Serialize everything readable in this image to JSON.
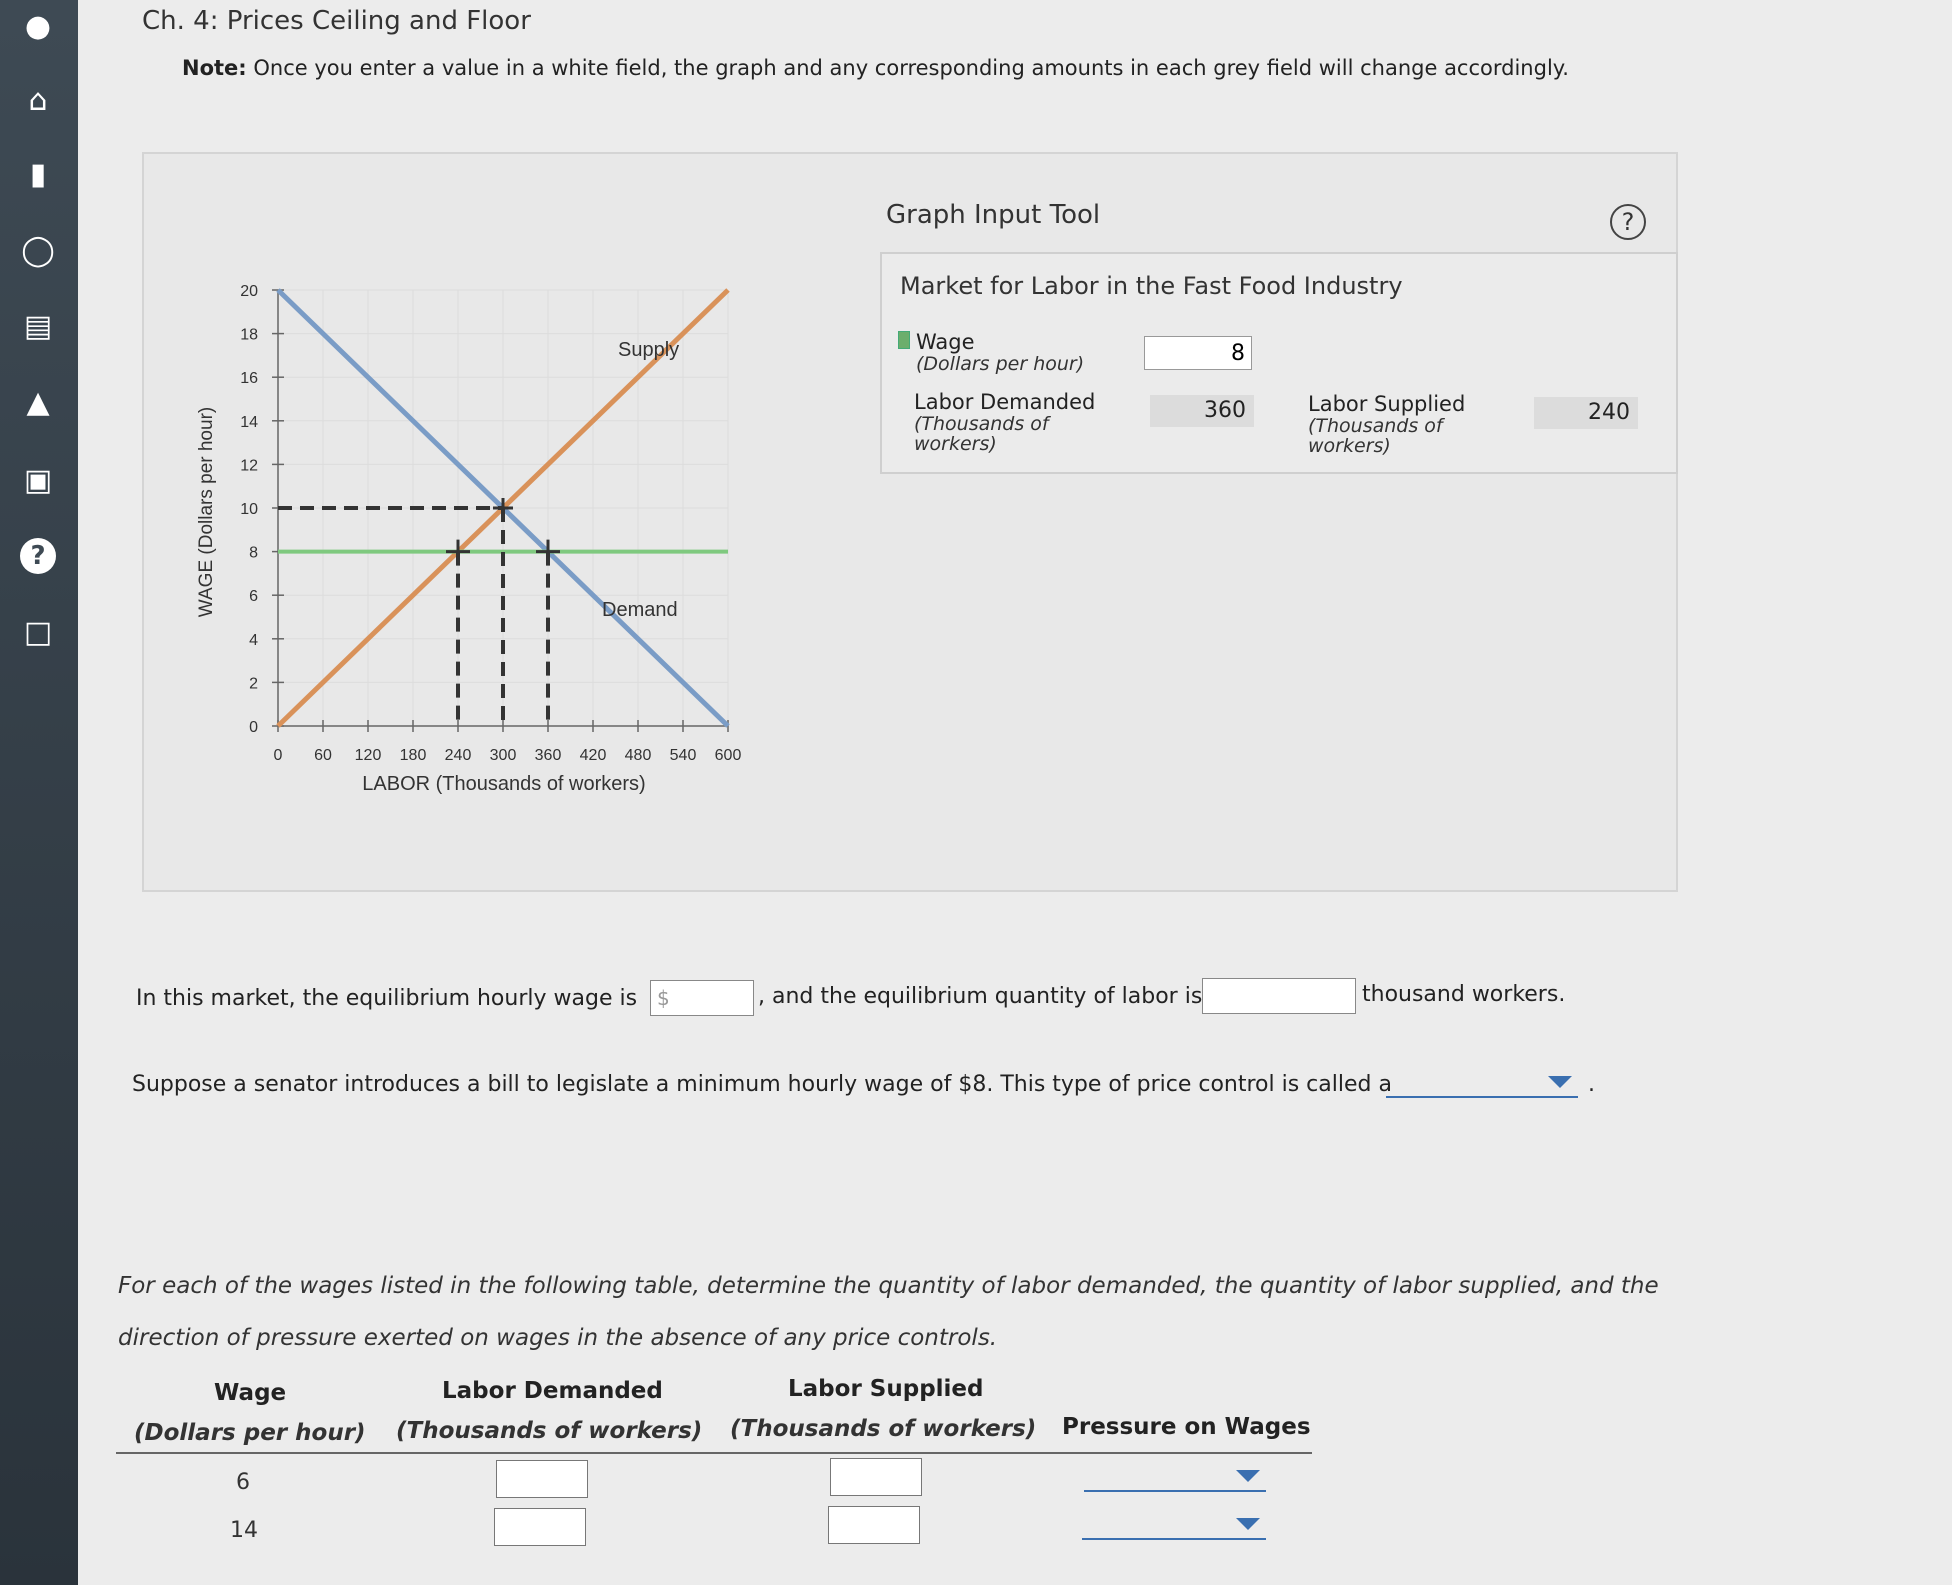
{
  "sidebar": {
    "items": [
      "person-icon",
      "home-icon",
      "notebook-icon",
      "compass-icon",
      "book-icon",
      "graduation-cap-icon",
      "briefcase-icon",
      "help-icon",
      "feedback-icon"
    ]
  },
  "header": {
    "title": "Ch. 4: Prices Ceiling and Floor",
    "note_label": "Note:",
    "note_text": " Once you enter a value in a white field, the graph and any corresponding amounts in each grey field will change accordingly."
  },
  "chart_data": {
    "type": "line",
    "xlabel": "LABOR (Thousands of workers)",
    "ylabel": "WAGE (Dollars per hour)",
    "xlim": [
      0,
      600
    ],
    "ylim": [
      0,
      20
    ],
    "x_ticks": [
      0,
      60,
      120,
      180,
      240,
      300,
      360,
      420,
      480,
      540,
      600
    ],
    "y_ticks": [
      0,
      2,
      4,
      6,
      8,
      10,
      12,
      14,
      16,
      18,
      20
    ],
    "series": [
      {
        "name": "Supply",
        "color": "#d9925a",
        "x": [
          0,
          600
        ],
        "y": [
          0,
          20
        ]
      },
      {
        "name": "Demand",
        "color": "#7a9cc6",
        "x": [
          0,
          600
        ],
        "y": [
          20,
          0
        ]
      }
    ],
    "wage_line": {
      "y": 8,
      "color": "#7fc97f"
    },
    "equilibrium": {
      "x": 300,
      "y": 10
    },
    "markers": [
      {
        "x": 240,
        "y": 8
      },
      {
        "x": 360,
        "y": 8
      }
    ]
  },
  "graph_tool": {
    "title": "Graph Input Tool",
    "help": "?",
    "market_title": "Market for Labor in the Fast Food Industry",
    "wage_label": "Wage",
    "wage_sub": "(Dollars per hour)",
    "wage_value": "8",
    "ld_label": "Labor Demanded",
    "ld_sub1": "(Thousands of",
    "ld_sub2": "workers)",
    "ld_value": "360",
    "ls_label": "Labor Supplied",
    "ls_sub1": "(Thousands of",
    "ls_sub2": "workers)",
    "ls_value": "240"
  },
  "question1": {
    "text_a": "In this market, the equilibrium hourly wage is",
    "dollar": "$",
    "text_b": ", and the equilibrium quantity of labor is",
    "text_c": "thousand workers."
  },
  "question2": {
    "text": "Suppose a senator introduces a bill to legislate a minimum hourly wage of $8. This type of price control is called a",
    "period": "."
  },
  "instructions": "For each of the wages listed in the following table, determine the quantity of labor demanded, the quantity of labor supplied, and the direction of pressure exerted on wages in the absence of any price controls.",
  "table": {
    "headers": {
      "wage": "Wage",
      "wage_sub": "(Dollars per hour)",
      "ld": "Labor Demanded",
      "ld_sub": "(Thousands of workers)",
      "ls": "Labor Supplied",
      "ls_sub": "(Thousands of workers)",
      "pressure": "Pressure on Wages"
    },
    "rows": [
      {
        "wage": "6"
      },
      {
        "wage": "14"
      }
    ]
  }
}
